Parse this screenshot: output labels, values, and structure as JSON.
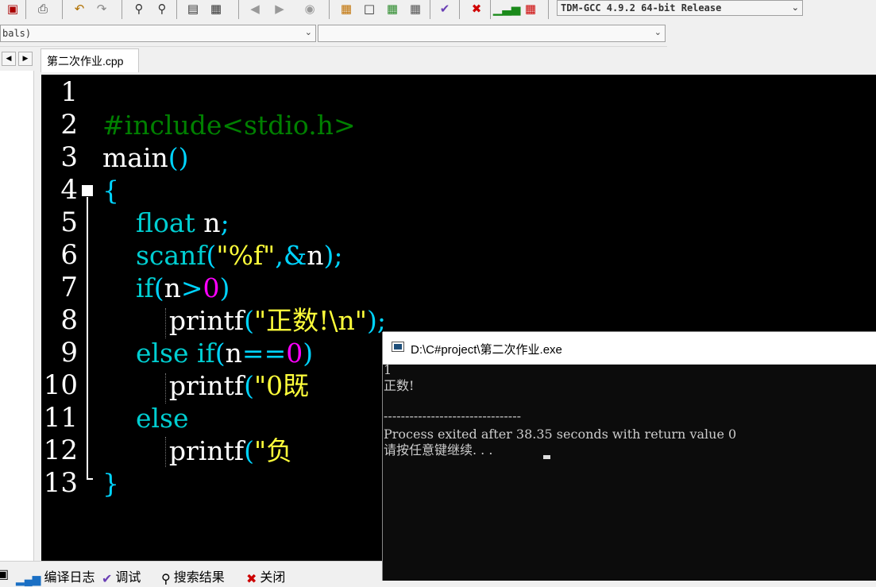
{
  "toolbar": {
    "compiler": "TDM-GCC 4.9.2 64-bit Release"
  },
  "toolbar2": {
    "class_combo": "bals)",
    "member_combo": ""
  },
  "tabs": {
    "file": "第二次作业.cpp"
  },
  "editor": {
    "line_numbers": [
      "1",
      "2",
      "3",
      "4",
      "5",
      "6",
      "7",
      "8",
      "9",
      "10",
      "11",
      "12",
      "13"
    ]
  },
  "bottom_tabs": {
    "compile_log": "编译日志",
    "debug": "调试",
    "search": "搜索结果",
    "close": "关闭"
  },
  "console": {
    "title": "D:\\C#project\\第二次作业.exe",
    "lines": [
      "1",
      "正数!",
      "",
      "--------------------------------",
      "Process exited after 38.35 seconds with return value 0",
      "请按任意键继续. . . "
    ]
  }
}
